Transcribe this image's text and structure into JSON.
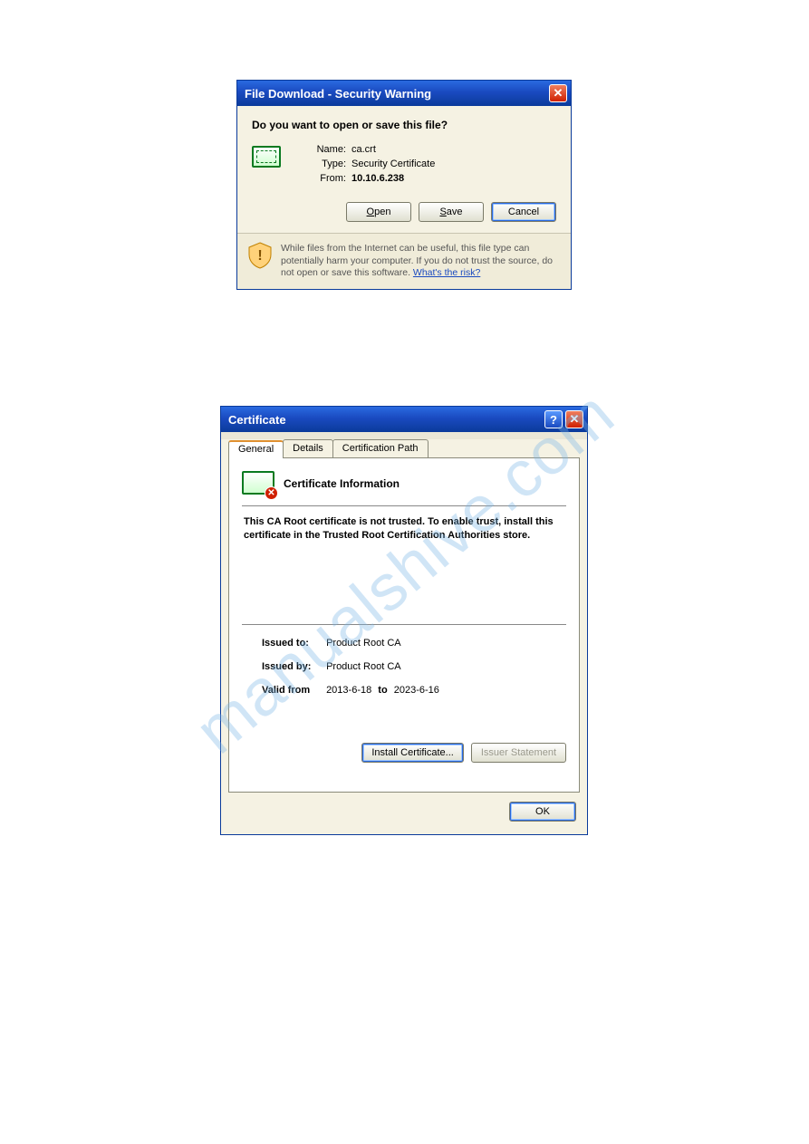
{
  "watermark": "manualshive.com",
  "dialog1": {
    "title": "File Download - Security Warning",
    "question": "Do you want to open or save this file?",
    "name_label": "Name:",
    "type_label": "Type:",
    "from_label": "From:",
    "name_value": "ca.crt",
    "type_value": "Security Certificate",
    "from_value": "10.10.6.238",
    "open_btn": "Open",
    "save_btn": "Save",
    "cancel_btn": "Cancel",
    "warning_text": "While files from the Internet can be useful, this file type can potentially harm your computer. If you do not trust the source, do not open or save this software. ",
    "risk_link": "What's the risk?"
  },
  "dialog2": {
    "title": "Certificate",
    "tabs": {
      "general": "General",
      "details": "Details",
      "path": "Certification Path"
    },
    "header": "Certificate Information",
    "message": "This CA Root certificate is not trusted. To enable trust, install this certificate in the Trusted Root Certification Authorities store.",
    "issued_to_label": "Issued to:",
    "issued_to": "Product Root CA",
    "issued_by_label": "Issued by:",
    "issued_by": "Product Root CA",
    "valid_from_label": "Valid from",
    "valid_from": "2013-6-18",
    "valid_to_label": "to",
    "valid_to": "2023-6-16",
    "install_btn": "Install Certificate...",
    "issuer_btn": "Issuer Statement",
    "ok_btn": "OK"
  }
}
